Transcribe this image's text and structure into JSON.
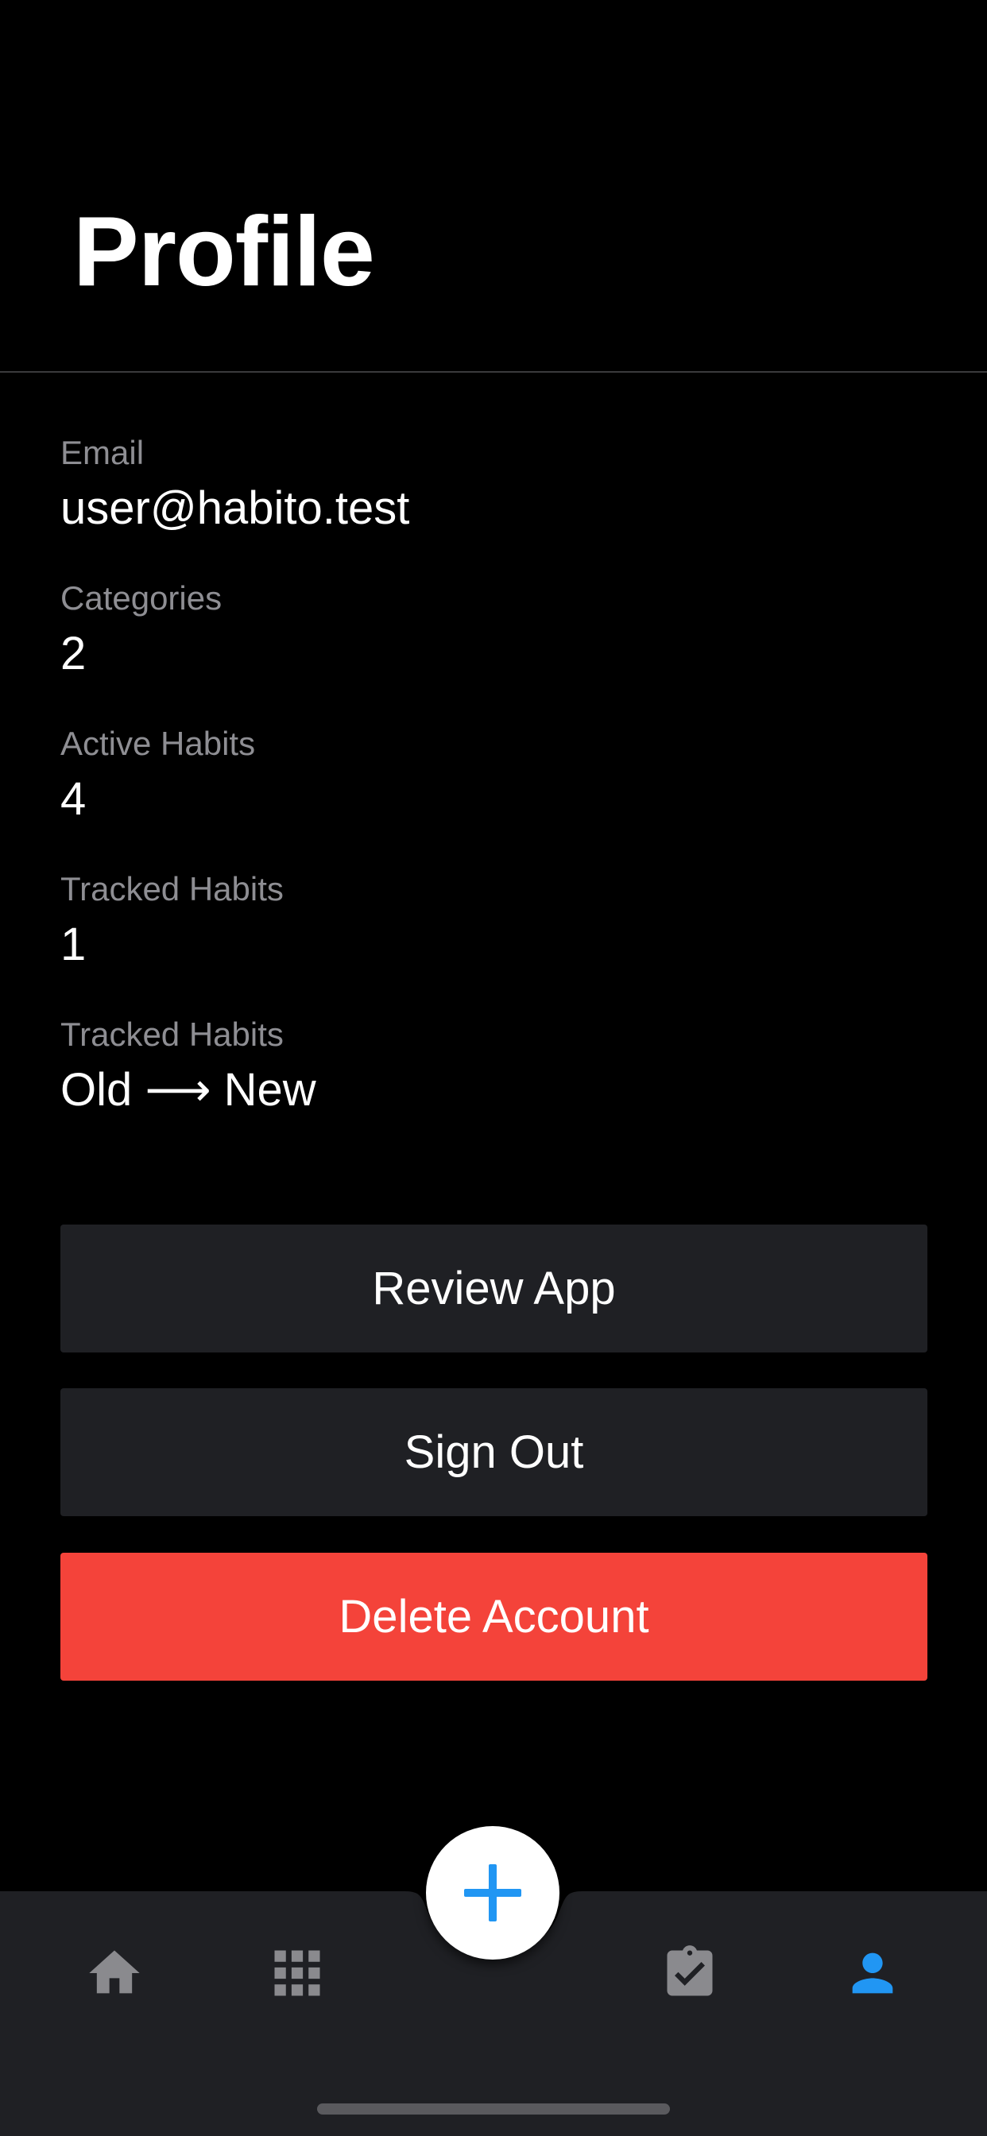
{
  "header": {
    "title": "Profile"
  },
  "profile": {
    "fields": [
      {
        "label": "Email",
        "value": "user@habito.test"
      },
      {
        "label": "Categories",
        "value": "2"
      },
      {
        "label": "Active Habits",
        "value": "4"
      },
      {
        "label": "Tracked Habits",
        "value": "1"
      },
      {
        "label": "Tracked Habits",
        "value": "Old ⟶ New"
      }
    ]
  },
  "actions": {
    "review_label": "Review App",
    "signout_label": "Sign Out",
    "delete_label": "Delete Account"
  },
  "tabbar": {
    "items": [
      {
        "icon": "home-icon",
        "active": false
      },
      {
        "icon": "grid-icon",
        "active": false
      },
      {
        "icon": "clipboard-check-icon",
        "active": false
      },
      {
        "icon": "person-icon",
        "active": true
      }
    ],
    "fab_icon": "plus-icon"
  },
  "colors": {
    "background": "#000000",
    "surface": "#1f2024",
    "danger": "#f4433a",
    "accent": "#2196f3",
    "muted_text": "#8e8e93",
    "inactive_icon": "#8a8a8e"
  }
}
